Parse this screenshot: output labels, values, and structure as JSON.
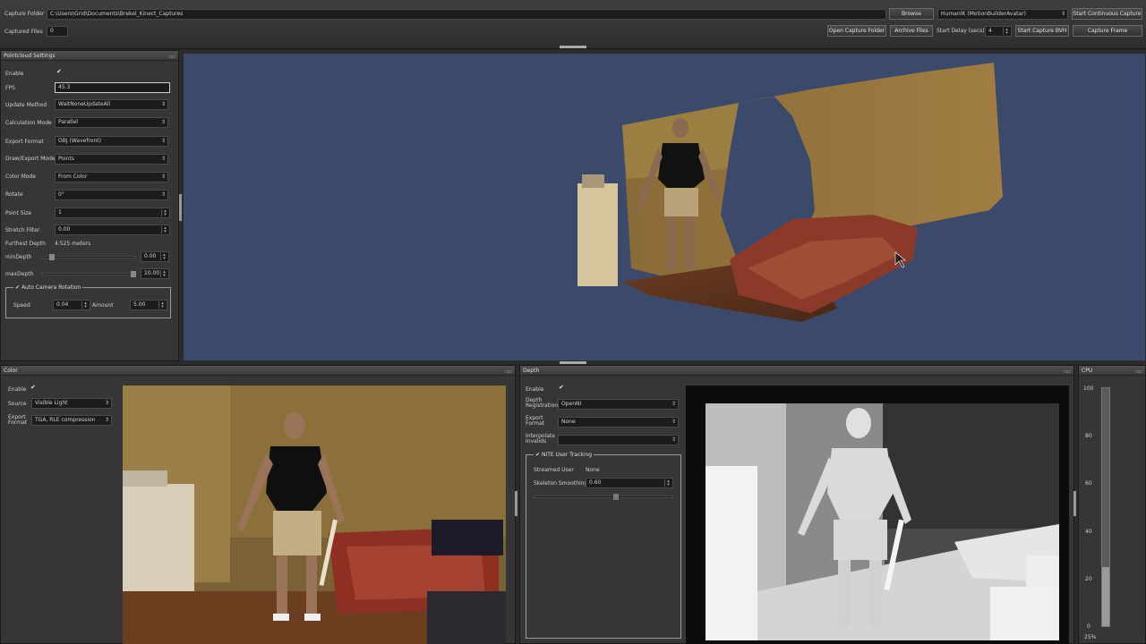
{
  "topbar": {
    "capture_folder_label": "Capture Folder",
    "capture_folder_path": "C:\\Users\\Grid\\Documents\\Brekel_Kinect_Captures",
    "browse_label": "Browse",
    "skeleton_format": "HumanIK (MotionBuilderAvatar)",
    "start_continuous_label": "Start Continuous Capture",
    "captured_files_label": "Captured Files",
    "captured_files_value": "0",
    "open_folder_label": "Open Capture Folder",
    "archive_label": "Archive Files",
    "start_delay_label": "Start Delay (secs)",
    "start_delay_value": "4",
    "start_bvh_label": "Start Capture BVH",
    "capture_frame_label": "Capture Frame"
  },
  "pointcloud": {
    "title": "Pointcloud Settings",
    "rows": {
      "enable": "Enable",
      "fps_label": "FPS",
      "fps_value": "45.3",
      "update_label": "Update Method",
      "update_value": "WaitNoneUpdateAll",
      "calc_label": "Calculation Mode",
      "calc_value": "Parallel",
      "export_label": "Export Format",
      "export_value": "OBJ (Wavefront)",
      "draw_label": "Draw/Export Mode",
      "draw_value": "Points",
      "color_label": "Color Mode",
      "color_value": "From Color",
      "rotate_label": "Rotate",
      "rotate_value": "0°",
      "psize_label": "Point Size",
      "psize_value": "1",
      "stretch_label": "Stretch Filter",
      "stretch_value": "0.00",
      "furthest_label": "Furthest Depth",
      "furthest_value": "4.525 meters",
      "min_label": "minDepth",
      "min_value": "0.00",
      "max_label": "maxDepth",
      "max_value": "10.00",
      "autorot_label": "Auto Camera Rotation",
      "speed_label": "Speed",
      "speed_value": "0.04",
      "amount_label": "Amount",
      "amount_value": "5.00"
    },
    "min_depth_fraction": 0.08,
    "max_depth_fraction": 1.0
  },
  "color_panel": {
    "title": "Color",
    "enable": "Enable",
    "source_label": "Source",
    "source_value": "Visible Light",
    "export_label": "Export Format",
    "export_value": "TGA, RLE compression"
  },
  "depth_panel": {
    "title": "Depth",
    "enable": "Enable",
    "reg_label": "Depth Registration",
    "reg_value": "OpenNI",
    "export_label": "Export Format",
    "export_value": "None",
    "interp_label": "Interpolate Invalids",
    "interp_value": "",
    "tracking_label": "NITE User Tracking",
    "streamed_label": "Streamed User",
    "streamed_value": "None",
    "smoothing_label": "Skeleton Smoothing",
    "smoothing_value": "0.60"
  },
  "cpu_panel": {
    "title": "CPU",
    "ticks": [
      "100",
      "80",
      "60",
      "40",
      "20",
      "0"
    ],
    "usage_label": "25%",
    "usage_fraction": 0.25
  },
  "colors": {
    "viewport_bg": "#3b4a6b",
    "panel_bg": "#363636"
  }
}
